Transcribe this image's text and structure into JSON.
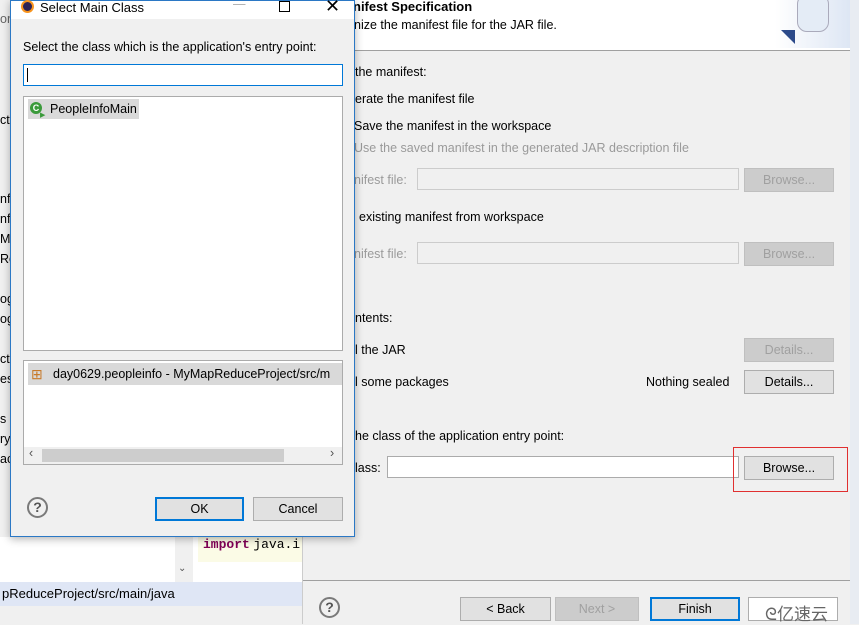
{
  "background_ide": {
    "left_fragments": [
      "or",
      "ct",
      "nf",
      "nf",
      "Ma",
      "Re",
      "og",
      "og",
      "ct",
      "es",
      "s",
      "ry",
      "aci"
    ],
    "status_path": "pReduceProject/src/main/java",
    "code_keyword": "import",
    "code_rest": "java.i"
  },
  "wizard": {
    "title_fragment": "nifest Specification",
    "description": "nize the manifest file for the JAR file.",
    "manifest_label": "the manifest:",
    "generate_option": "erate the manifest file",
    "save_option": "Save the manifest in the workspace",
    "use_saved_option": "Use the saved manifest in the generated JAR description file",
    "manifest_file_label": "nifest file:",
    "browse_label": "Browse...",
    "use_existing_option": "existing manifest from workspace",
    "manifest_file_label2": "nifest file:",
    "contents_label": "ntents:",
    "seal_jar_option": "l the JAR",
    "details_label": "Details...",
    "seal_packages_option": "l some packages",
    "nothing_sealed": "Nothing sealed",
    "entry_point_label": "he class of the application entry point:",
    "main_class_label": "lass:",
    "main_class_value": "",
    "back_label": "< Back",
    "next_label": "Next >",
    "finish_label": "Finish",
    "watermark": "亿速云"
  },
  "dialog": {
    "title": "Select Main Class",
    "prompt": "Select the class which is the application's entry point:",
    "filter_value": "",
    "types": [
      {
        "label": "PeopleInfoMain",
        "icon": "class-main-icon"
      }
    ],
    "packages": [
      {
        "label": "day0629.peopleinfo - MyMapReduceProject/src/m",
        "icon": "package-icon"
      }
    ],
    "ok_label": "OK",
    "cancel_label": "Cancel",
    "highlight_color": "#d9d9d9",
    "accent": "#0078d7"
  }
}
